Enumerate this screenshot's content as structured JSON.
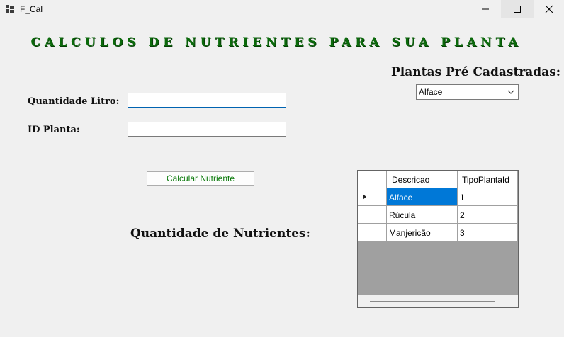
{
  "window": {
    "title": "F_Cal"
  },
  "heading": "CALCULOS DE NUTRIENTES PARA SUA PLANTA",
  "form": {
    "quantity_label": "Quantidade Litro:",
    "quantity_value": "",
    "plant_id_label": "ID Planta:",
    "plant_id_value": "",
    "calculate_label": "Calcular Nutriente",
    "nutrients_label": "Quantidade de Nutrientes:"
  },
  "plants": {
    "label": "Plantas Pré Cadastradas:",
    "selected": "Alface"
  },
  "grid": {
    "columns": [
      "Descricao",
      "TipoPlantaId"
    ],
    "rows": [
      {
        "descricao": "Alface",
        "tipo": "1"
      },
      {
        "descricao": "Rúcula",
        "tipo": "2"
      },
      {
        "descricao": "Manjericão",
        "tipo": "3"
      }
    ]
  },
  "colors": {
    "heading": "#0b6a0b",
    "button_text": "#0b7a0b",
    "selection": "#0078d7",
    "focus": "#0063b1"
  }
}
